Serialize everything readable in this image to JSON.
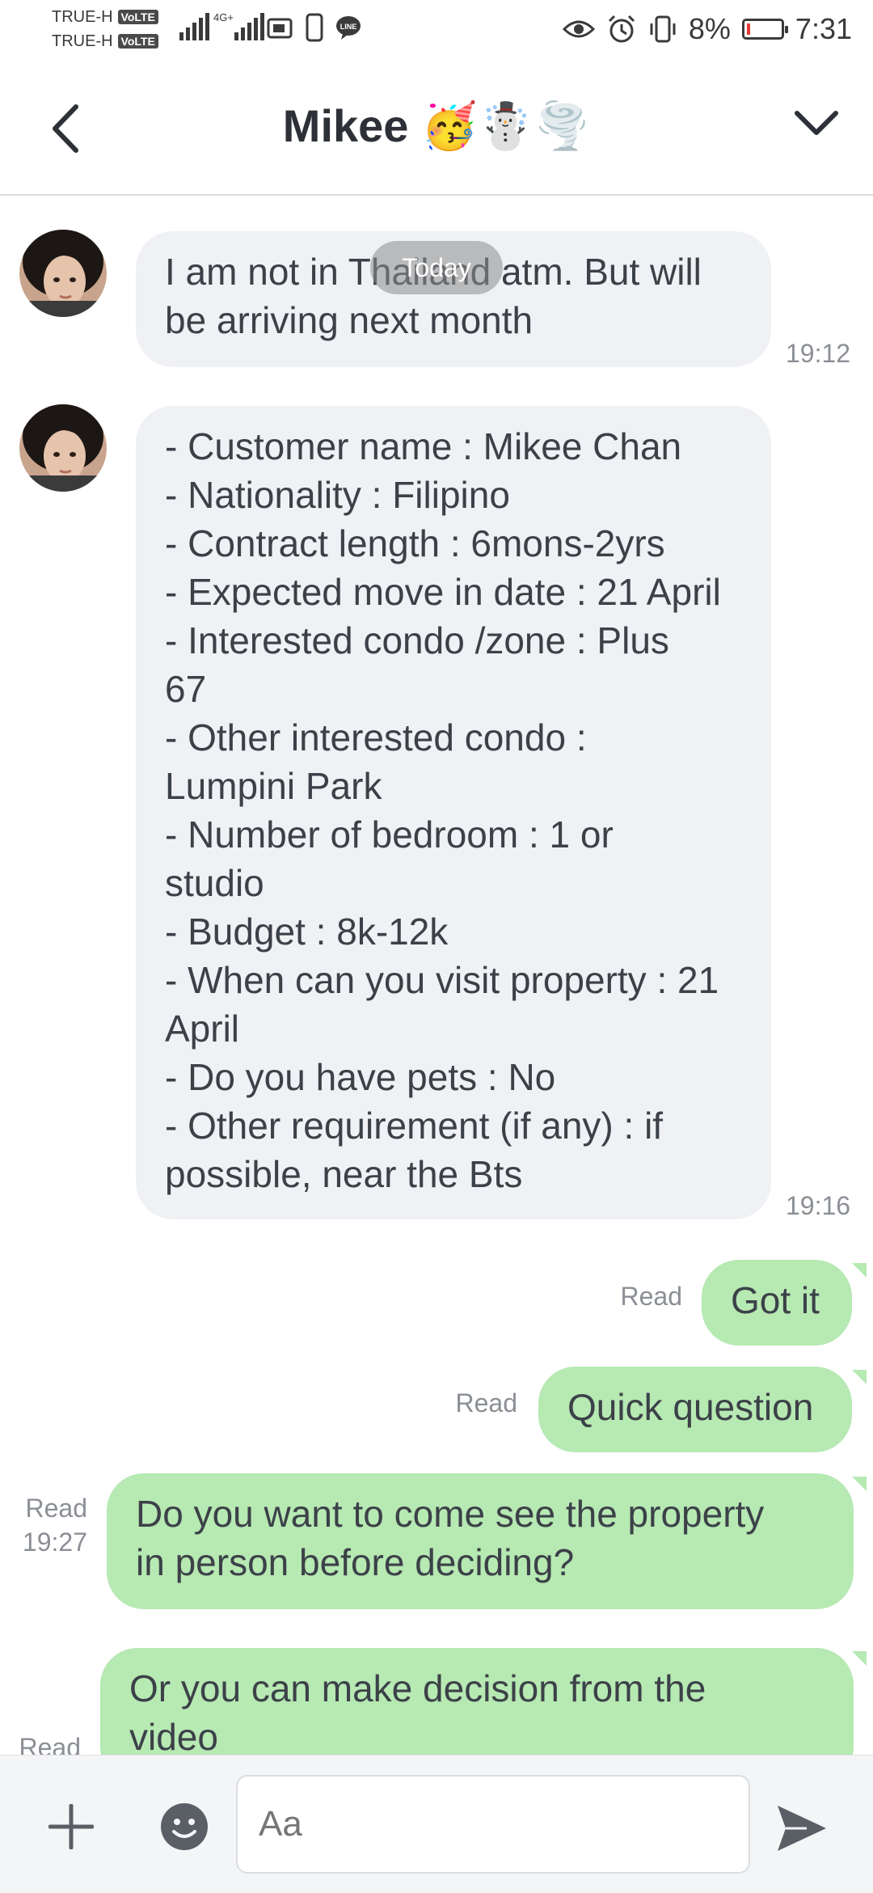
{
  "status_bar": {
    "carrier1": "TRUE-H",
    "carrier2": "TRUE-H",
    "volte": "VoLTE",
    "network": "4G+",
    "battery_pct": "8%",
    "time": "7:31",
    "battery_level": 0.08,
    "battery_color": "#e53935"
  },
  "header": {
    "title": "Mikee 🥳☃️🌪️",
    "back_icon": "chevron-left-icon",
    "menu_icon": "chevron-down-icon"
  },
  "chat": {
    "date_chip": "Today",
    "messages": [
      {
        "sender": "Mikee",
        "direction": "incoming",
        "lines": [
          "I am not in Thailand atm. But will",
          "be arriving next month"
        ],
        "time": "19:12"
      },
      {
        "sender": "Mikee",
        "direction": "incoming",
        "lines": [
          "- Customer name : Mikee Chan",
          "- Nationality : Filipino",
          "- Contract length : 6mons-2yrs",
          "- Expected move in date : 21 April",
          "- Interested condo /zone : Plus",
          "67",
          "- Other interested condo :",
          "Lumpini Park",
          "- Number of bedroom  :  1 or",
          "studio",
          "- Budget : 8k-12k",
          "- When can you visit property : 21",
          "April",
          "- Do you have pets : No",
          "- Other requirement (if any) : if",
          "possible, near the Bts"
        ],
        "time": "19:16"
      },
      {
        "direction": "outgoing",
        "text": "Got it",
        "status": "Read"
      },
      {
        "direction": "outgoing",
        "text": "Quick question",
        "status": "Read"
      },
      {
        "direction": "outgoing",
        "lines": [
          "Do you want to come see the property",
          "in person before deciding?"
        ],
        "status": "Read",
        "time": "19:27"
      },
      {
        "direction": "outgoing",
        "lines": [
          "Or you can make decision from the",
          "video"
        ],
        "status": "Read"
      }
    ]
  },
  "composer": {
    "placeholder": "Aa",
    "plus_icon": "plus-icon",
    "emoji_icon": "emoji-icon",
    "send_icon": "send-icon"
  },
  "colors": {
    "incoming_bubble": "#f0f1f4",
    "outgoing_bubble": "#b7e9b3",
    "text": "#3c4148",
    "meta": "#8b8f95"
  }
}
